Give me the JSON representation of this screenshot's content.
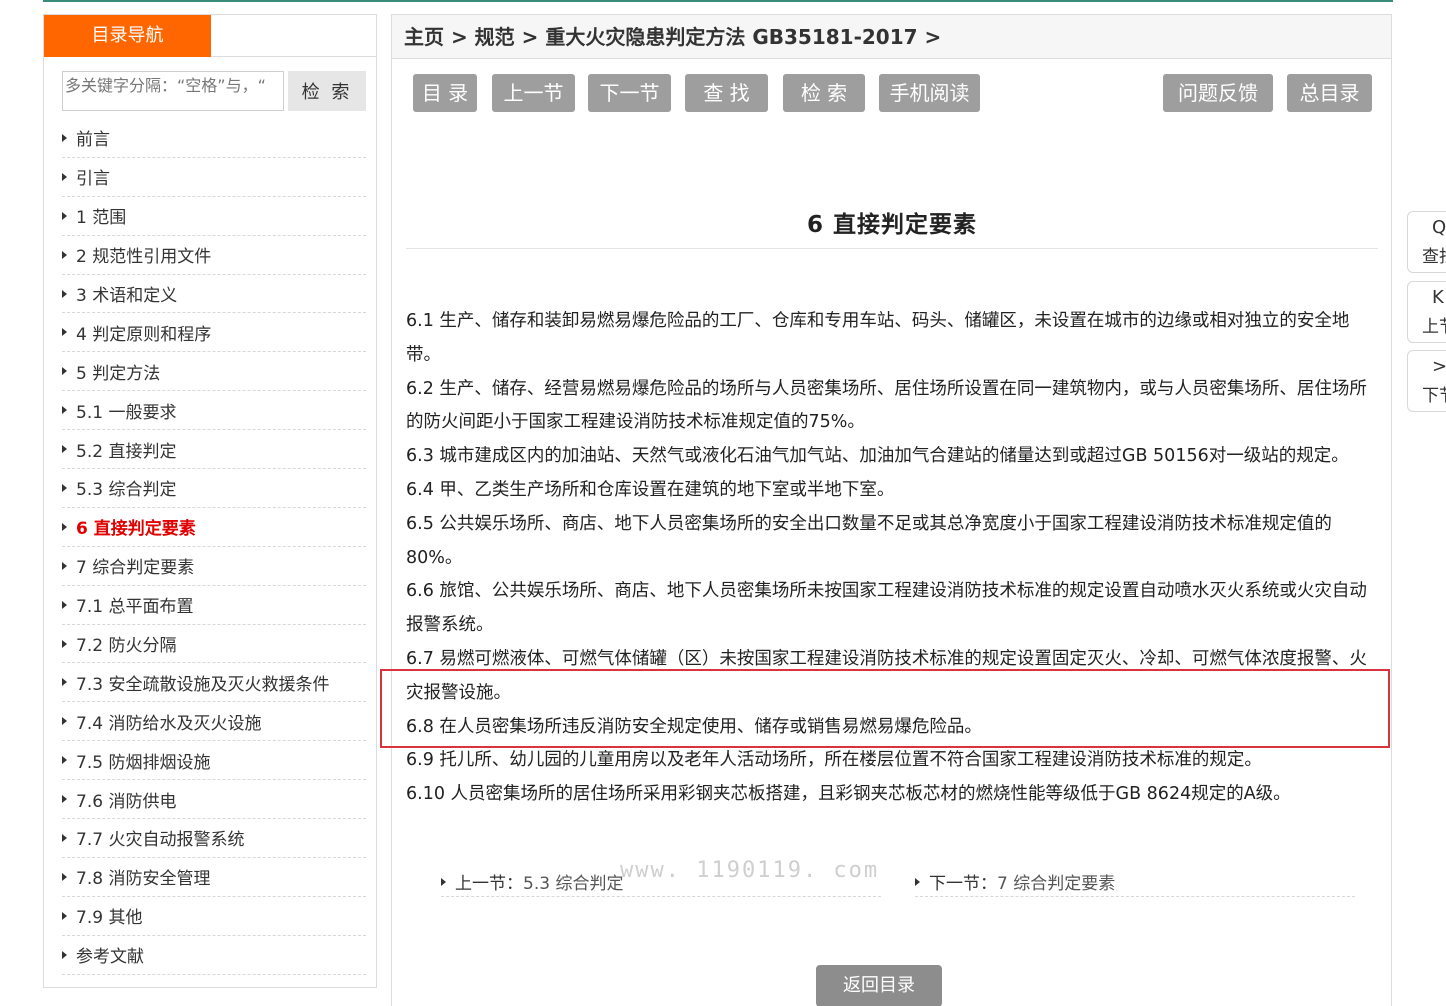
{
  "sidebar": {
    "tab_label": "目录导航",
    "search_placeholder": "多关键字分隔：“空格”与，“",
    "search_button": "检 索",
    "items": [
      {
        "label": "前言",
        "active": false
      },
      {
        "label": "引言",
        "active": false
      },
      {
        "label": "1 范围",
        "active": false
      },
      {
        "label": "2 规范性引用文件",
        "active": false
      },
      {
        "label": "3 术语和定义",
        "active": false
      },
      {
        "label": "4 判定原则和程序",
        "active": false
      },
      {
        "label": "5 判定方法",
        "active": false
      },
      {
        "label": "5.1 一般要求",
        "active": false
      },
      {
        "label": "5.2 直接判定",
        "active": false
      },
      {
        "label": "5.3 综合判定",
        "active": false
      },
      {
        "label": "6 直接判定要素",
        "active": true
      },
      {
        "label": "7 综合判定要素",
        "active": false
      },
      {
        "label": "7.1 总平面布置",
        "active": false
      },
      {
        "label": "7.2 防火分隔",
        "active": false
      },
      {
        "label": "7.3 安全疏散设施及灭火救援条件",
        "active": false
      },
      {
        "label": "7.4 消防给水及灭火设施",
        "active": false
      },
      {
        "label": "7.5 防烟排烟设施",
        "active": false
      },
      {
        "label": "7.6 消防供电",
        "active": false
      },
      {
        "label": "7.7 火灾自动报警系统",
        "active": false
      },
      {
        "label": "7.8 消防安全管理",
        "active": false
      },
      {
        "label": "7.9 其他",
        "active": false
      },
      {
        "label": "参考文献",
        "active": false
      }
    ]
  },
  "breadcrumb": "主页 > 规范 > 重大火灾隐患判定方法 GB35181-2017 >",
  "toolbar": {
    "toc": "目 录",
    "prev": "上一节",
    "next": "下一节",
    "find": "查 找",
    "search": "检 索",
    "mobile": "手机阅读",
    "feedback": "问题反馈",
    "all_toc": "总目录"
  },
  "article": {
    "title": "6  直接判定要素",
    "clauses": [
      {
        "num": "6.1",
        "text": "生产、储存和装卸易燃易爆危险品的工厂、仓库和专用车站、码头、储罐区，未设置在城市的边缘或相对独立的安全地带。"
      },
      {
        "num": "6.2",
        "text": "生产、储存、经营易燃易爆危险品的场所与人员密集场所、居住场所设置在同一建筑物内，或与人员密集场所、居住场所的防火间距小于国家工程建设消防技术标准规定值的75%。"
      },
      {
        "num": "6.3",
        "text": "城市建成区内的加油站、天然气或液化石油气加气站、加油加气合建站的储量达到或超过GB 50156对一级站的规定。"
      },
      {
        "num": "6.4",
        "text": "甲、乙类生产场所和仓库设置在建筑的地下室或半地下室。"
      },
      {
        "num": "6.5",
        "text": "公共娱乐场所、商店、地下人员密集场所的安全出口数量不足或其总净宽度小于国家工程建设消防技术标准规定值的80%。"
      },
      {
        "num": "6.6",
        "text": "旅馆、公共娱乐场所、商店、地下人员密集场所未按国家工程建设消防技术标准的规定设置自动喷水灭火系统或火灾自动报警系统。"
      },
      {
        "num": "6.7",
        "text": "易燃可燃液体、可燃气体储罐（区）未按国家工程建设消防技术标准的规定设置固定灭火、冷却、可燃气体浓度报警、火灾报警设施。"
      },
      {
        "num": "6.8",
        "text": "在人员密集场所违反消防安全规定使用、储存或销售易燃易爆危险品。"
      },
      {
        "num": "6.9",
        "text": "托儿所、幼儿园的儿童用房以及老年人活动场所，所在楼层位置不符合国家工程建设消防技术标准的规定。"
      },
      {
        "num": "6.10",
        "text": "人员密集场所的居住场所采用彩钢夹芯板搭建，且彩钢夹芯板芯材的燃烧性能等级低于GB 8624规定的A级。"
      }
    ],
    "prev_label": "上一节：",
    "prev_link": "5.3 综合判定",
    "next_label": "下一节：",
    "next_link": "7 综合判定要素",
    "back_button": "返回目录"
  },
  "watermark": "www. 1190119. com",
  "float": {
    "find_icon": "search-icon",
    "find_label": "查找",
    "prev_icon": "prev-section-icon",
    "prev_label": "上节",
    "next_icon": "next-section-icon",
    "next_label": "下节"
  },
  "colors": {
    "accent": "#ff6600",
    "active_nav": "#e00000",
    "button_gray": "#9e9e9e",
    "highlight_border": "#d9343d"
  }
}
